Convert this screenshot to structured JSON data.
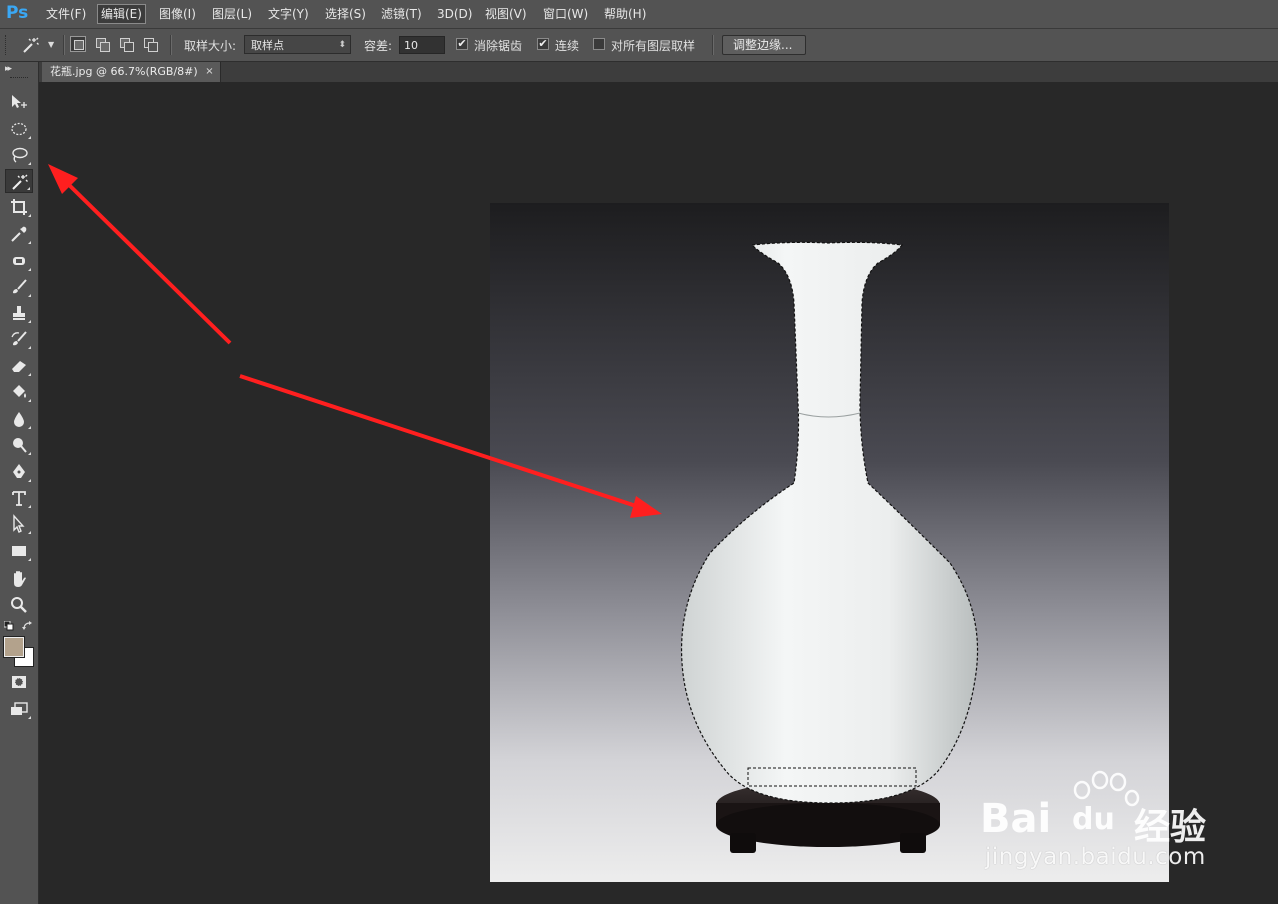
{
  "app": {
    "logo": "Ps"
  },
  "menu": {
    "items": [
      "文件(F)",
      "编辑(E)",
      "图像(I)",
      "图层(L)",
      "文字(Y)",
      "选择(S)",
      "滤镜(T)",
      "3D(D)",
      "视图(V)",
      "窗口(W)",
      "帮助(H)"
    ],
    "active": "编辑(E)"
  },
  "options": {
    "sample_size_label": "取样大小:",
    "sample_size_value": "取样点",
    "tolerance_label": "容差:",
    "tolerance_value": "10",
    "anti_alias_label": "消除锯齿",
    "anti_alias_checked": true,
    "contiguous_label": "连续",
    "contiguous_checked": true,
    "sample_all_layers_label": "对所有图层取样",
    "sample_all_layers_checked": false,
    "refine_edge_label": "调整边缘..."
  },
  "document": {
    "tab_title": "花瓶.jpg @ 66.7%(RGB/8#)",
    "close_glyph": "×"
  },
  "tools": [
    "move-tool",
    "marquee-tool",
    "lasso-tool",
    "magic-wand-tool",
    "crop-tool",
    "eyedropper-tool",
    "spot-healing-tool",
    "brush-tool",
    "clone-stamp-tool",
    "history-brush-tool",
    "eraser-tool",
    "paint-bucket-tool",
    "blur-tool",
    "dodge-tool",
    "pen-tool",
    "type-tool",
    "path-selection-tool",
    "rectangle-tool",
    "hand-tool",
    "zoom-tool"
  ],
  "selected_tool": "magic-wand-tool",
  "colors": {
    "foreground": "#b3a28c",
    "background": "#ffffff",
    "arrow": "#ff1f1f",
    "ps_blue": "#3aa8f5"
  },
  "watermark": {
    "brand": "Bai",
    "paw": "du",
    "product": "经验",
    "url": "jingyan.baidu.com"
  }
}
